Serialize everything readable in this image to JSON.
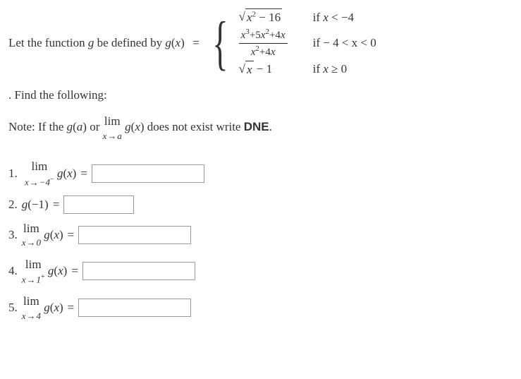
{
  "definition": {
    "intro": "Let the function ",
    "gvar": "g",
    "defined_by": " be defined by ",
    "g_of_x": "g(x)",
    "pieces": [
      {
        "expr_sqrt_left": "x",
        "expr_sqrt_sup": "2",
        "expr_sqrt_right": " − 16",
        "cond_prefix": "if ",
        "cond_var": "x",
        "cond_rel": " < −4"
      },
      {
        "frac_num": "x³+5x²+4x",
        "frac_den": "x²+4x",
        "cond_prefix": "if ",
        "cond": " − 4 < x < 0"
      },
      {
        "expr_sqrt_x": "x",
        "expr_tail": " − 1",
        "cond_prefix": "if ",
        "cond_var": "x",
        "cond_rel": " ≥ 0"
      }
    ]
  },
  "find_text": ". Find the following:",
  "note": {
    "prefix": "Note: If the ",
    "ga": "g(a)",
    "or": "  or ",
    "lim_top": "lim",
    "lim_bottom_left": "x",
    "lim_bottom_arrow": "→",
    "lim_bottom_right": "a",
    "gx": " g(x) ",
    "does_not": " does not exist write ",
    "dne": "DNE",
    "period": "."
  },
  "problems": [
    {
      "num": "1.",
      "lim_top": "lim",
      "lim_bottom": "x→−4⁻",
      "expr": "g(x)",
      "has_lim": true
    },
    {
      "num": "2.",
      "expr": "g(−1)",
      "has_lim": false
    },
    {
      "num": "3.",
      "lim_top": "lim",
      "lim_bottom": "x→0",
      "expr": "g(x)",
      "has_lim": true
    },
    {
      "num": "4.",
      "lim_top": "lim",
      "lim_bottom": "x→1⁺",
      "expr": "g(x)",
      "has_lim": true
    },
    {
      "num": "5.",
      "lim_top": "lim",
      "lim_bottom": "x→4",
      "expr": "g(x)",
      "has_lim": true
    }
  ]
}
